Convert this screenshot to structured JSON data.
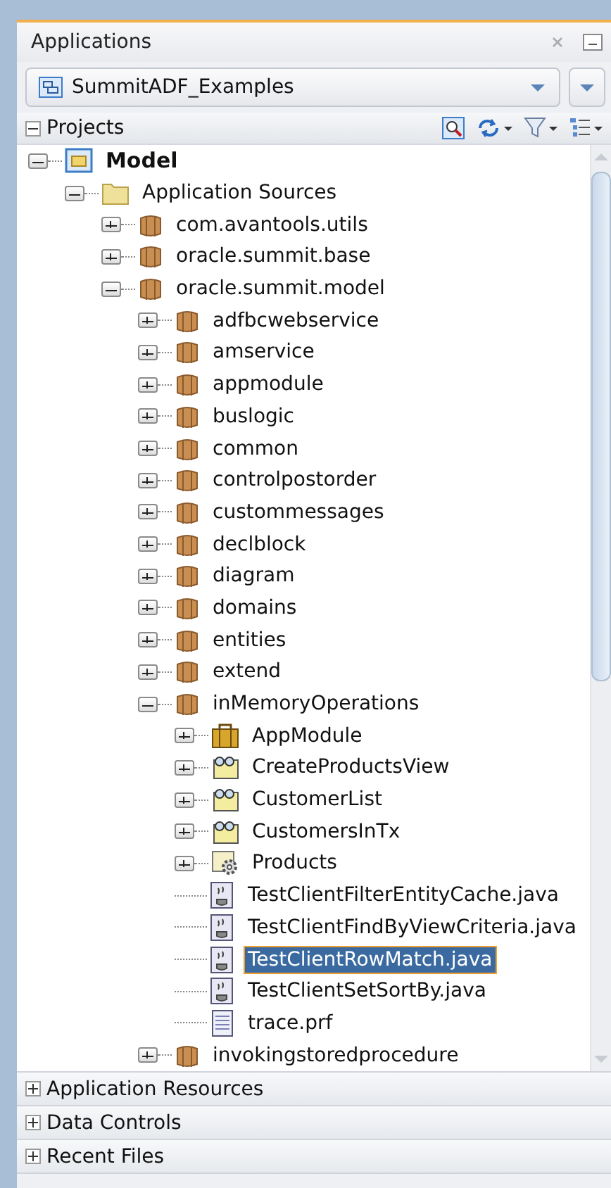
{
  "panel": {
    "title": "Applications",
    "application": "SummitADF_Examples"
  },
  "projects": {
    "label": "Projects",
    "expanded": true
  },
  "tree": [
    {
      "label": "Model",
      "kind": "project",
      "expanded": true,
      "selected": false,
      "children": [
        {
          "label": "Application Sources",
          "kind": "folder",
          "expanded": true,
          "selected": false,
          "children": [
            {
              "label": "com.avantools.utils",
              "kind": "package",
              "expanded": false,
              "selected": false
            },
            {
              "label": "oracle.summit.base",
              "kind": "package",
              "expanded": false,
              "selected": false
            },
            {
              "label": "oracle.summit.model",
              "kind": "package",
              "expanded": true,
              "selected": false,
              "children": [
                {
                  "label": "adfbcwebservice",
                  "kind": "package",
                  "expanded": false,
                  "selected": false
                },
                {
                  "label": "amservice",
                  "kind": "package",
                  "expanded": false,
                  "selected": false
                },
                {
                  "label": "appmodule",
                  "kind": "package",
                  "expanded": false,
                  "selected": false
                },
                {
                  "label": "buslogic",
                  "kind": "package",
                  "expanded": false,
                  "selected": false
                },
                {
                  "label": "common",
                  "kind": "package",
                  "expanded": false,
                  "selected": false
                },
                {
                  "label": "controlpostorder",
                  "kind": "package",
                  "expanded": false,
                  "selected": false
                },
                {
                  "label": "custommessages",
                  "kind": "package",
                  "expanded": false,
                  "selected": false
                },
                {
                  "label": "declblock",
                  "kind": "package",
                  "expanded": false,
                  "selected": false
                },
                {
                  "label": "diagram",
                  "kind": "package",
                  "expanded": false,
                  "selected": false
                },
                {
                  "label": "domains",
                  "kind": "package",
                  "expanded": false,
                  "selected": false
                },
                {
                  "label": "entities",
                  "kind": "package",
                  "expanded": false,
                  "selected": false
                },
                {
                  "label": "extend",
                  "kind": "package",
                  "expanded": false,
                  "selected": false
                },
                {
                  "label": "inMemoryOperations",
                  "kind": "package",
                  "expanded": true,
                  "selected": false,
                  "children": [
                    {
                      "label": "AppModule",
                      "kind": "appmodule",
                      "expanded": false,
                      "selected": false
                    },
                    {
                      "label": "CreateProductsView",
                      "kind": "view",
                      "expanded": false,
                      "selected": false
                    },
                    {
                      "label": "CustomerList",
                      "kind": "view",
                      "expanded": false,
                      "selected": false
                    },
                    {
                      "label": "CustomersInTx",
                      "kind": "view",
                      "expanded": false,
                      "selected": false
                    },
                    {
                      "label": "Products",
                      "kind": "entity",
                      "expanded": false,
                      "selected": false
                    },
                    {
                      "label": "TestClientFilterEntityCache.java",
                      "kind": "java",
                      "selected": false
                    },
                    {
                      "label": "TestClientFindByViewCriteria.java",
                      "kind": "java",
                      "selected": false
                    },
                    {
                      "label": "TestClientRowMatch.java",
                      "kind": "java",
                      "selected": true
                    },
                    {
                      "label": "TestClientSetSortBy.java",
                      "kind": "java",
                      "selected": false
                    },
                    {
                      "label": "trace.prf",
                      "kind": "file",
                      "selected": false
                    }
                  ]
                },
                {
                  "label": "invokingstoredprocedure",
                  "kind": "package",
                  "expanded": false,
                  "selected": false
                }
              ]
            }
          ]
        }
      ]
    }
  ],
  "sections": [
    {
      "label": "Application Resources",
      "expanded": false
    },
    {
      "label": "Data Controls",
      "expanded": false
    },
    {
      "label": "Recent Files",
      "expanded": false
    }
  ]
}
